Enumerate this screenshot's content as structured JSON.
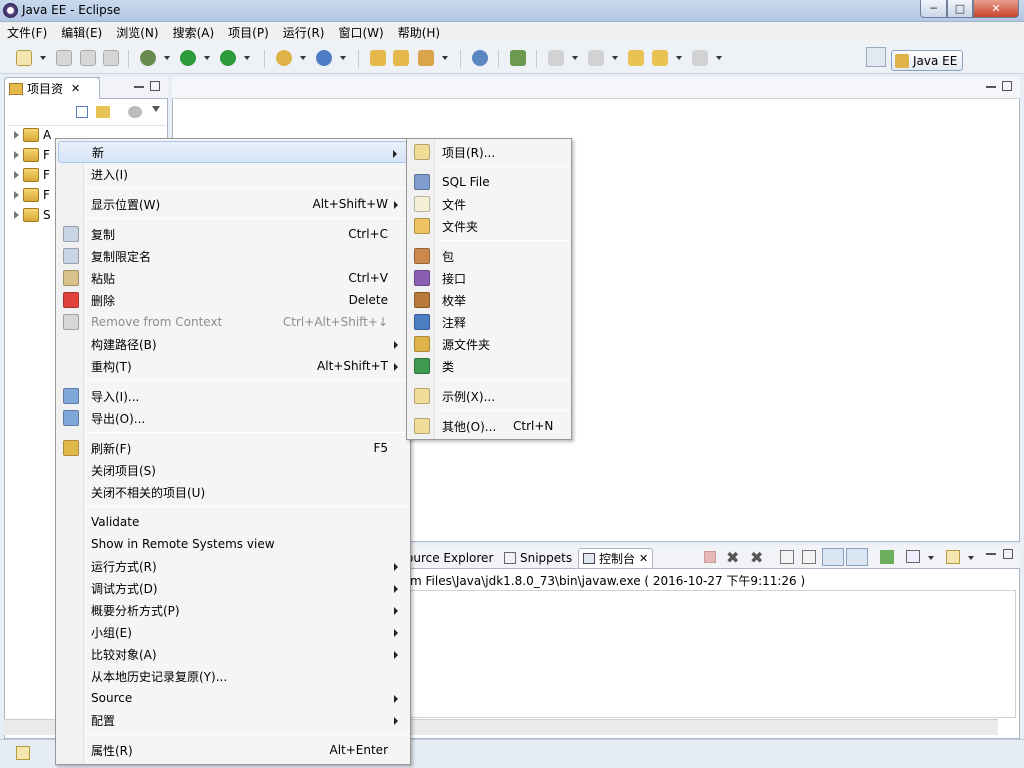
{
  "window": {
    "title": "Java EE  -  Eclipse",
    "minimize": "─",
    "maximize": "□",
    "close": "✕"
  },
  "menubar": [
    "文件(F)",
    "编辑(E)",
    "浏览(N)",
    "搜索(A)",
    "项目(P)",
    "运行(R)",
    "窗口(W)",
    "帮助(H)"
  ],
  "perspective": {
    "label": "Java EE"
  },
  "project_explorer": {
    "tab_label": "项目资",
    "tree": [
      "A",
      "F",
      "F",
      "F",
      "S"
    ]
  },
  "console": {
    "tabs": [
      "ource Explorer",
      "Snippets",
      "控制台"
    ],
    "path_text": "m Files\\Java\\jdk1.8.0_73\\bin\\javaw.exe ( 2016-10-27 下午9:11:26 )"
  },
  "context_menu": {
    "items": [
      {
        "label": "新",
        "arrow": true,
        "highlight": true,
        "icon": "none"
      },
      {
        "label": "进入(I)",
        "icon": "none"
      },
      {
        "sep": true
      },
      {
        "label": "显示位置(W)",
        "shortcut": "Alt+Shift+W",
        "arrow": true,
        "icon": "none"
      },
      {
        "sep": true
      },
      {
        "label": "复制",
        "shortcut": "Ctrl+C",
        "icon": "copy-icon"
      },
      {
        "label": "复制限定名",
        "icon": "copy-qualified-icon"
      },
      {
        "label": "粘贴",
        "shortcut": "Ctrl+V",
        "icon": "paste-icon"
      },
      {
        "label": "删除",
        "shortcut": "Delete",
        "icon": "delete-icon"
      },
      {
        "label": "Remove from Context",
        "shortcut": "Ctrl+Alt+Shift+↓",
        "disabled": true,
        "icon": "remove-context-icon"
      },
      {
        "label": "构建路径(B)",
        "arrow": true,
        "icon": "none"
      },
      {
        "label": "重构(T)",
        "shortcut": "Alt+Shift+T",
        "arrow": true,
        "icon": "none"
      },
      {
        "sep": true
      },
      {
        "label": "导入(I)...",
        "icon": "import-icon"
      },
      {
        "label": "导出(O)...",
        "icon": "export-icon"
      },
      {
        "sep": true
      },
      {
        "label": "刷新(F)",
        "shortcut": "F5",
        "icon": "refresh-icon"
      },
      {
        "label": "关闭项目(S)",
        "icon": "none"
      },
      {
        "label": "关闭不相关的项目(U)",
        "icon": "none"
      },
      {
        "sep": true
      },
      {
        "label": "Validate",
        "icon": "none"
      },
      {
        "label": "Show in Remote Systems view",
        "icon": "none"
      },
      {
        "label": "运行方式(R)",
        "arrow": true,
        "icon": "none"
      },
      {
        "label": "调试方式(D)",
        "arrow": true,
        "icon": "none"
      },
      {
        "label": "概要分析方式(P)",
        "arrow": true,
        "icon": "none"
      },
      {
        "label": "小组(E)",
        "arrow": true,
        "icon": "none"
      },
      {
        "label": "比较对象(A)",
        "arrow": true,
        "icon": "none"
      },
      {
        "label": "从本地历史记录复原(Y)...",
        "icon": "none"
      },
      {
        "label": "Source",
        "arrow": true,
        "icon": "none"
      },
      {
        "label": "配置",
        "arrow": true,
        "icon": "none"
      },
      {
        "sep": true
      },
      {
        "label": "属性(R)",
        "shortcut": "Alt+Enter",
        "icon": "none"
      }
    ]
  },
  "submenu": {
    "items": [
      {
        "label": "项目(R)...",
        "icon": "new-project-icon"
      },
      {
        "sep": true
      },
      {
        "label": "SQL File",
        "icon": "sql-file-icon"
      },
      {
        "label": "文件",
        "icon": "file-icon"
      },
      {
        "label": "文件夹",
        "icon": "folder-icon"
      },
      {
        "sep": true
      },
      {
        "label": "包",
        "icon": "package-icon"
      },
      {
        "label": "接口",
        "icon": "interface-icon"
      },
      {
        "label": "枚举",
        "icon": "enum-icon"
      },
      {
        "label": "注释",
        "icon": "annotation-icon"
      },
      {
        "label": "源文件夹",
        "icon": "source-folder-icon"
      },
      {
        "label": "类",
        "icon": "class-icon"
      },
      {
        "sep": true
      },
      {
        "label": "示例(X)...",
        "icon": "example-icon"
      },
      {
        "sep": true
      },
      {
        "label": "其他(O)...",
        "shortcut": "Ctrl+N",
        "icon": "other-icon"
      }
    ]
  }
}
